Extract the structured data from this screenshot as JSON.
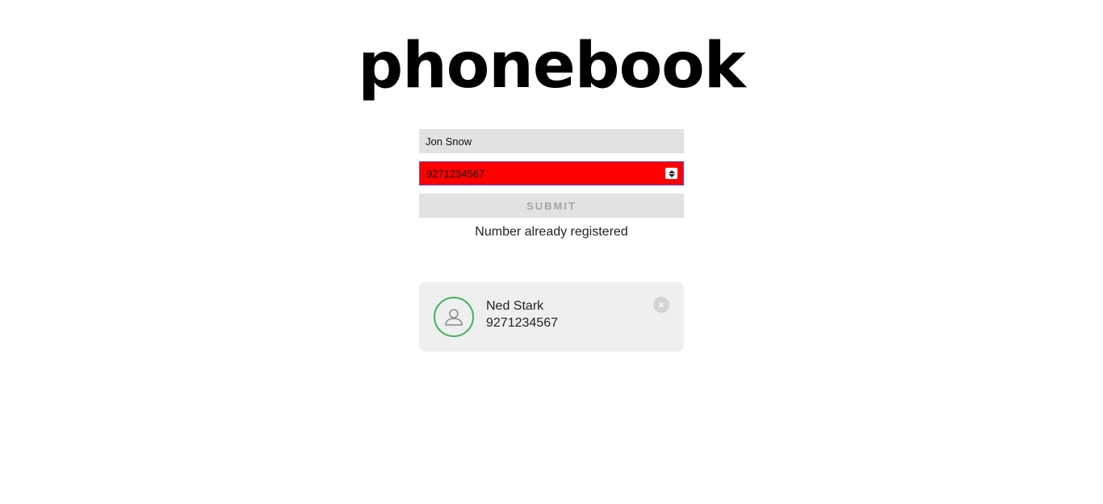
{
  "app": {
    "title": "phonebook"
  },
  "form": {
    "name_value": "Jon Snow",
    "phone_value": "9271234567",
    "submit_label": "SUBMIT",
    "error_message": "Number already registered"
  },
  "contacts": [
    {
      "name": "Ned Stark",
      "phone": "9271234567",
      "delete_label": "x",
      "avatar_icon": "user-icon"
    }
  ],
  "colors": {
    "error_field": "#ff0000",
    "avatar_ring": "#3fb35a",
    "field_bg": "#e2e2e2",
    "card_bg": "#efefef"
  }
}
